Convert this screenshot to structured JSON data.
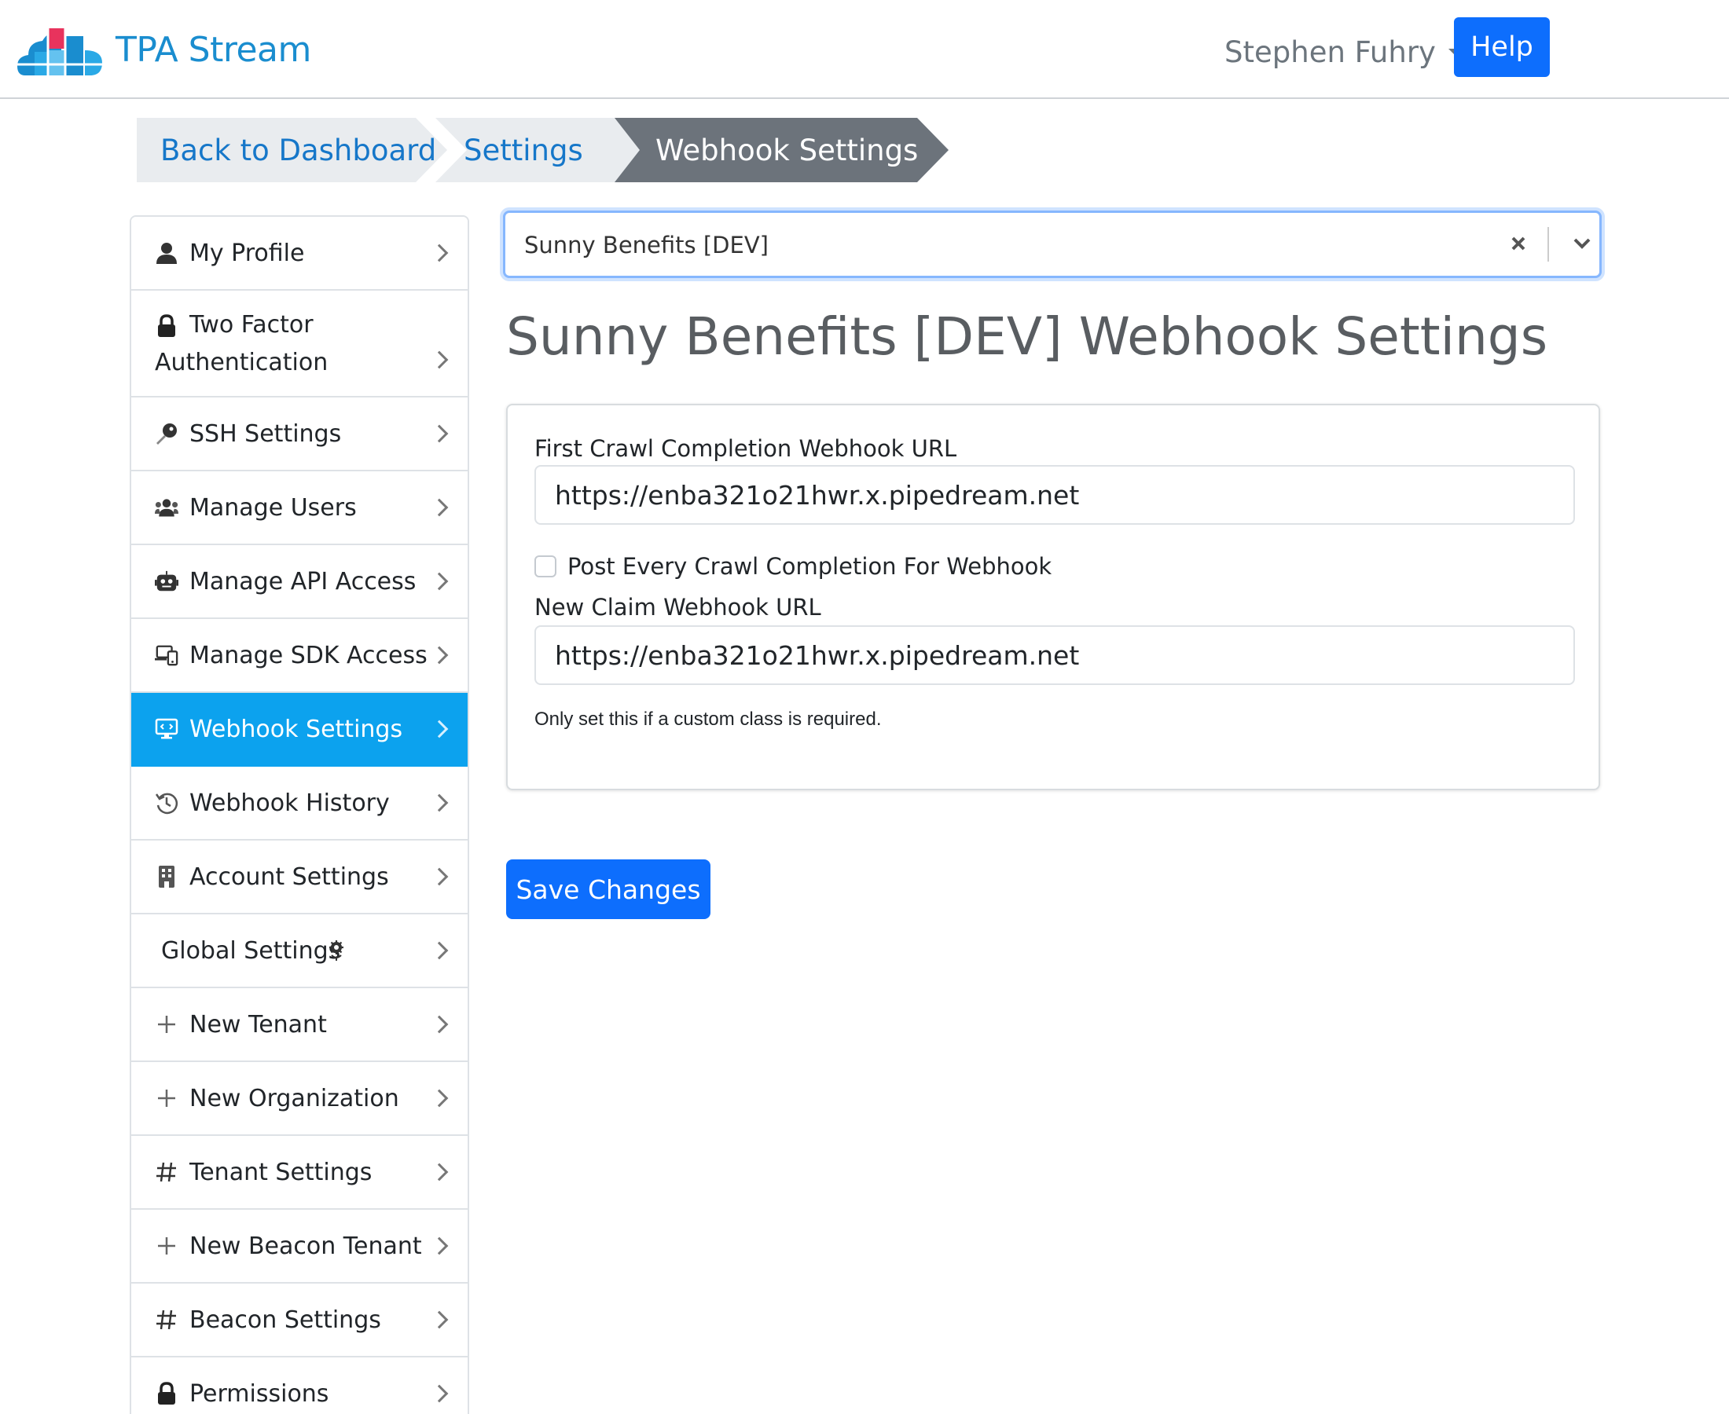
{
  "app": {
    "name": "TPA Stream"
  },
  "header": {
    "user_name": "Stephen Fuhry",
    "help_label": "Help"
  },
  "breadcrumb": [
    {
      "label": "Back to Dashboard"
    },
    {
      "label": "Settings"
    },
    {
      "label": "Webhook Settings"
    }
  ],
  "sidebar": {
    "items": [
      {
        "label": "My Profile",
        "icon": "user-icon"
      },
      {
        "label": "Two Factor",
        "label2": "Authentication",
        "icon": "lock-icon"
      },
      {
        "label": "SSH Settings",
        "icon": "key-icon"
      },
      {
        "label": "Manage Users",
        "icon": "users-icon"
      },
      {
        "label": "Manage API Access",
        "icon": "robot-icon"
      },
      {
        "label": "Manage SDK Access",
        "icon": "devices-icon"
      },
      {
        "label": "Webhook Settings",
        "icon": "webhook-monitor-icon",
        "active": true
      },
      {
        "label": "Webhook History",
        "icon": "history-icon"
      },
      {
        "label": "Account Settings",
        "icon": "building-icon"
      },
      {
        "label": "Global Settings",
        "icon": "globe-gear-icon"
      },
      {
        "label": "New Tenant",
        "icon": "plus-icon"
      },
      {
        "label": "New Organization",
        "icon": "plus-icon"
      },
      {
        "label": "Tenant Settings",
        "icon": "hashtag-icon"
      },
      {
        "label": "New Beacon Tenant",
        "icon": "plus-icon"
      },
      {
        "label": "Beacon Settings",
        "icon": "hashtag-icon"
      },
      {
        "label": "Permissions",
        "icon": "lock-icon"
      }
    ]
  },
  "main": {
    "tenant_select": {
      "value": "Sunny Benefits [DEV]"
    },
    "title": "Sunny Benefits [DEV] Webhook Settings",
    "form": {
      "first_crawl_label": "First Crawl Completion Webhook URL",
      "first_crawl_value": "https://enba321o21hwr.x.pipedream.net",
      "post_every_label": "Post Every Crawl Completion For Webhook",
      "post_every_checked": false,
      "new_claim_label": "New Claim Webhook URL",
      "new_claim_value": "https://enba321o21hwr.x.pipedream.net",
      "help_text": "Only set this if a custom class is required."
    },
    "save_label": "Save Changes"
  },
  "colors": {
    "primary": "#0d6efd",
    "sidebar_active": "#0ca2ee",
    "breadcrumb_active": "#6c737b",
    "breadcrumb_bg": "#e9ecef",
    "brand": "#1a8dcf"
  }
}
